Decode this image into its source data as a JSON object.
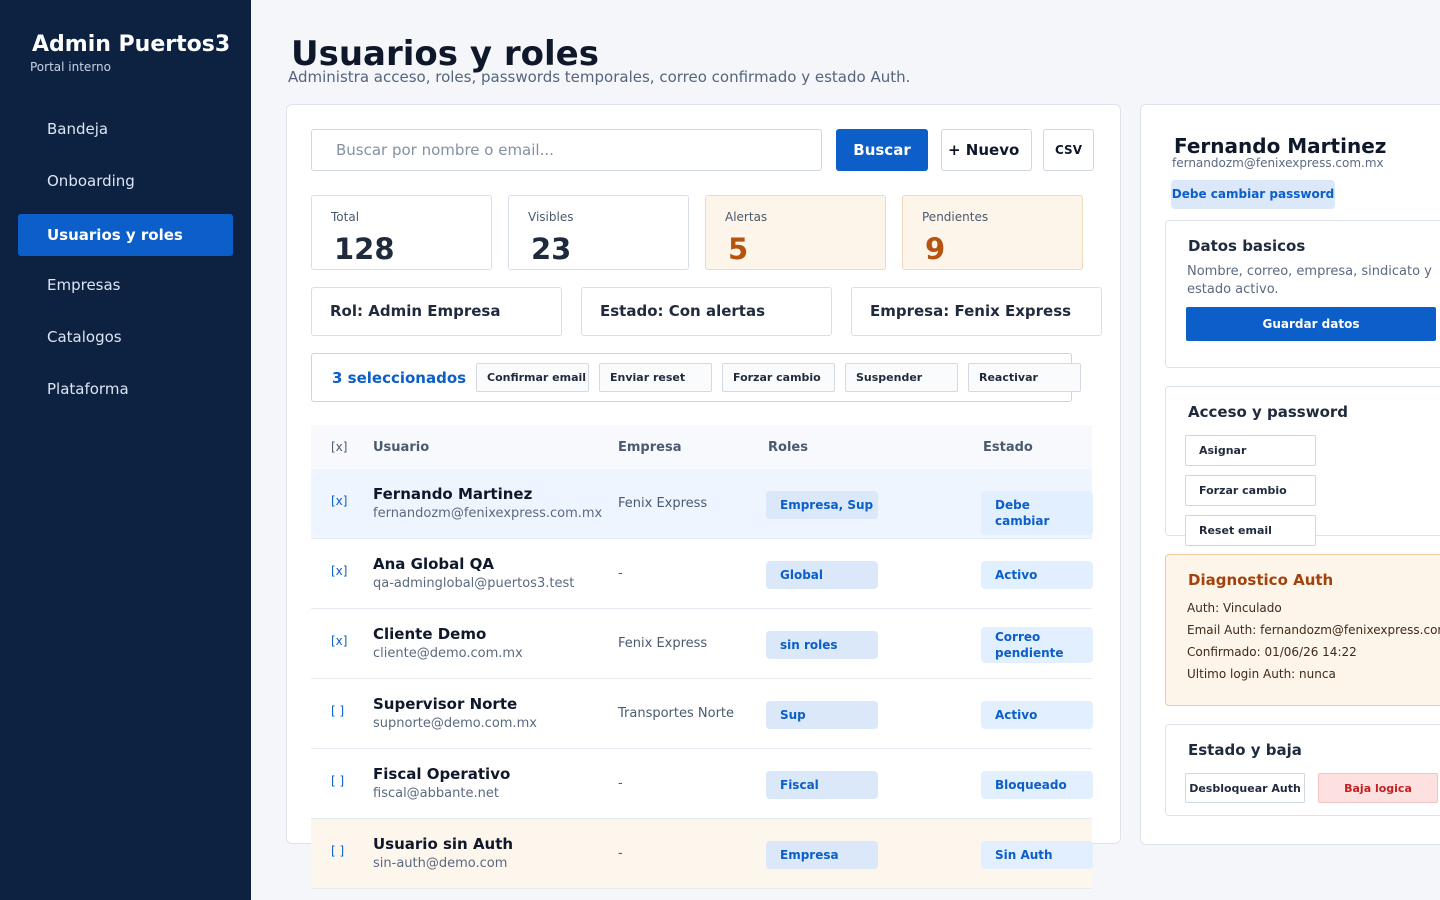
{
  "sidebar": {
    "brand": "Admin Puertos3",
    "subtitle": "Portal interno",
    "items": [
      {
        "label": "Bandeja"
      },
      {
        "label": "Onboarding"
      },
      {
        "label": "Usuarios y roles"
      },
      {
        "label": "Empresas"
      },
      {
        "label": "Catalogos"
      },
      {
        "label": "Plataforma"
      }
    ],
    "active_index": 2
  },
  "header": {
    "title": "Usuarios y roles",
    "subtitle": "Administra acceso, roles, passwords temporales, correo confirmado y estado Auth."
  },
  "toolbar": {
    "search_placeholder": "Buscar por nombre o email...",
    "search_label": "Buscar",
    "new_label": "+ Nuevo",
    "csv_label": "CSV"
  },
  "stats": [
    {
      "label": "Total",
      "value": "128"
    },
    {
      "label": "Visibles",
      "value": "23"
    },
    {
      "label": "Alertas",
      "value": "5"
    },
    {
      "label": "Pendientes",
      "value": "9"
    }
  ],
  "filters": {
    "role": "Rol: Admin Empresa",
    "state": "Estado: Con alertas",
    "company": "Empresa: Fenix Express"
  },
  "bulk": {
    "count": "3 seleccionados",
    "actions": [
      {
        "label": "Confirmar email"
      },
      {
        "label": "Enviar reset"
      },
      {
        "label": "Forzar cambio"
      },
      {
        "label": "Suspender"
      },
      {
        "label": "Reactivar"
      }
    ]
  },
  "table": {
    "headers": {
      "check": "[x]",
      "user": "Usuario",
      "company": "Empresa",
      "roles": "Roles",
      "state": "Estado"
    },
    "rows": [
      {
        "check": "[x]",
        "name": "Fernando Martinez",
        "email": "fernandozm@fenixexpress.com.mx",
        "company": "Fenix Express",
        "roles": "Empresa, Sup",
        "state": "Debe cambiar"
      },
      {
        "check": "[x]",
        "name": "Ana Global QA",
        "email": "qa-adminglobal@puertos3.test",
        "company": "-",
        "roles": "Global",
        "state": "Activo"
      },
      {
        "check": "[x]",
        "name": "Cliente Demo",
        "email": "cliente@demo.com.mx",
        "company": "Fenix Express",
        "roles": "sin roles",
        "state": "Correo pendiente"
      },
      {
        "check": "[ ]",
        "name": "Supervisor Norte",
        "email": "supnorte@demo.com.mx",
        "company": "Transportes Norte",
        "roles": "Sup",
        "state": "Activo"
      },
      {
        "check": "[ ]",
        "name": "Fiscal Operativo",
        "email": "fiscal@abbante.net",
        "company": "-",
        "roles": "Fiscal",
        "state": "Bloqueado"
      },
      {
        "check": "[ ]",
        "name": "Usuario sin Auth",
        "email": "sin-auth@demo.com",
        "company": "-",
        "roles": "Empresa",
        "state": "Sin Auth"
      }
    ]
  },
  "detail": {
    "name": "Fernando Martinez",
    "email": "fernandozm@fenixexpress.com.mx",
    "badge": "Debe cambiar password",
    "basic": {
      "title": "Datos basicos",
      "description": "Nombre, correo, empresa, sindicato y estado activo.",
      "save_label": "Guardar datos"
    },
    "access": {
      "title": "Acceso y password",
      "assign_label": "Asignar",
      "force_label": "Forzar cambio",
      "reset_label": "Reset email"
    },
    "diagnostic": {
      "title": "Diagnostico Auth",
      "auth": "Auth: Vinculado",
      "email": "Email Auth: fernandozm@fenixexpress.com.mx",
      "confirmed": "Confirmado: 01/06/26 14:22",
      "last_login": "Ultimo login Auth: nunca"
    },
    "status": {
      "title": "Estado y baja",
      "unlock_label": "Desbloquear Auth",
      "delete_label": "Baja logica"
    }
  },
  "colors": {
    "sidebar_bg": "#0d2240",
    "accent": "#0c5ec9",
    "warning": "#b5540f",
    "danger": "#c21f1f"
  }
}
